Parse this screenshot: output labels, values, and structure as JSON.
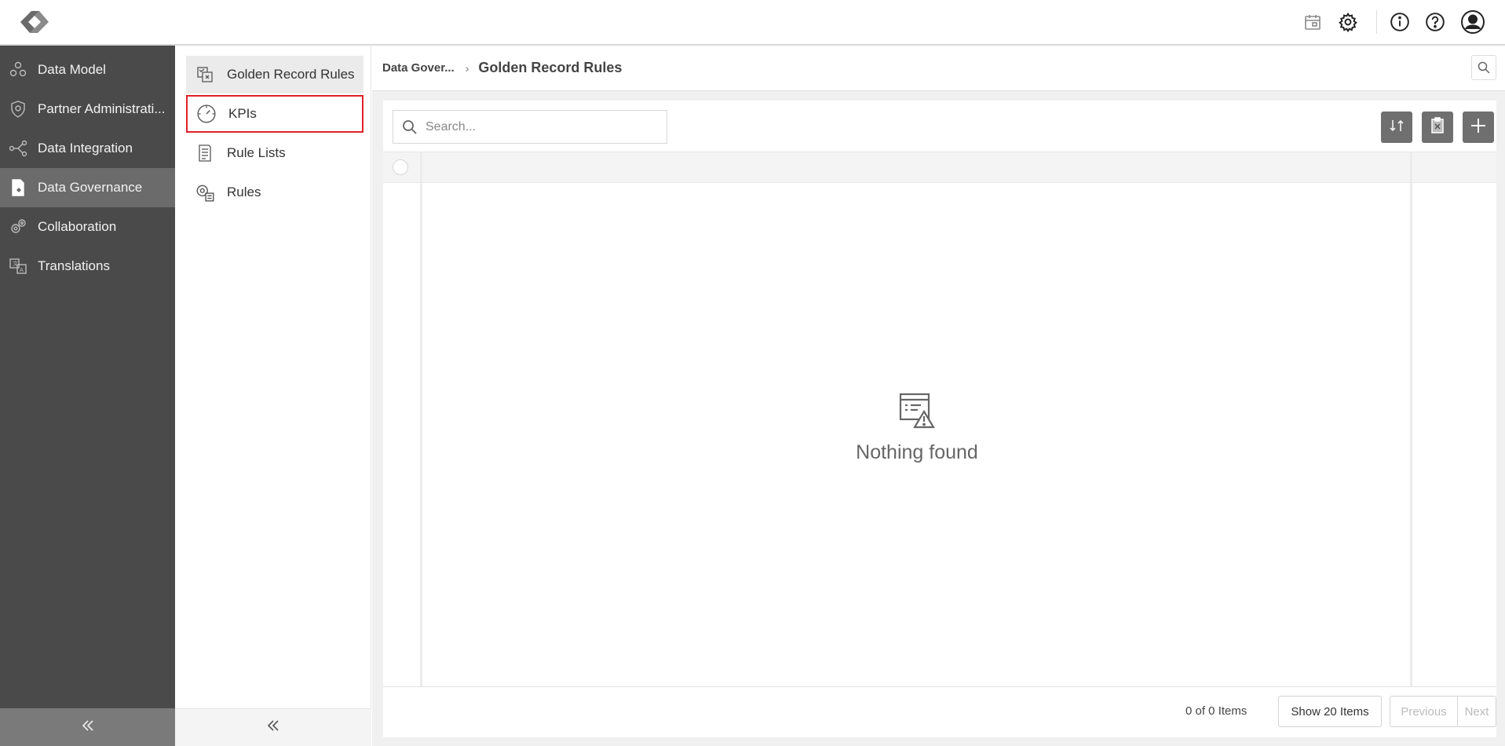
{
  "topbar": {
    "logo": "app-logo",
    "icons": [
      "calendar-icon",
      "gear-icon",
      "info-icon",
      "help-icon",
      "user-icon"
    ]
  },
  "sidebar": {
    "items": [
      {
        "label": "Data Model",
        "icon": "data-model-icon"
      },
      {
        "label": "Partner Administrati...",
        "icon": "shield-icon"
      },
      {
        "label": "Data Integration",
        "icon": "integration-icon"
      },
      {
        "label": "Data Governance",
        "icon": "governance-icon",
        "active": true
      },
      {
        "label": "Collaboration",
        "icon": "collaboration-icon"
      },
      {
        "label": "Translations",
        "icon": "translate-icon"
      }
    ],
    "collapse_icon": "double-chevron-left-icon"
  },
  "subnav": {
    "items": [
      {
        "label": "Golden Record Rules",
        "icon": "golden-record-icon"
      },
      {
        "label": "KPIs",
        "icon": "speedometer-icon"
      },
      {
        "label": "Rule Lists",
        "icon": "list-document-icon"
      },
      {
        "label": "Rules",
        "icon": "gear-document-icon"
      }
    ],
    "collapse_icon": "double-chevron-left-icon"
  },
  "breadcrumb": {
    "root": "Data Gover...",
    "separator": "›",
    "current": "Golden Record Rules"
  },
  "toolbar": {
    "search_placeholder": "Search...",
    "buttons": [
      "refresh-icon",
      "clear-icon",
      "add-icon"
    ]
  },
  "grid": {
    "empty_text": "Nothing found",
    "empty_icon": "empty-warning-icon"
  },
  "pagination": {
    "count": "0 of 0 Items",
    "page_size": "Show 20 Items",
    "previous": "Previous",
    "next": "Next"
  },
  "colors": {
    "sidebar_bg": "#4a4a4a",
    "sidebar_active": "#6b6b6b",
    "highlight_border": "#e0202a",
    "toolbar_button": "#6f6f6f"
  }
}
